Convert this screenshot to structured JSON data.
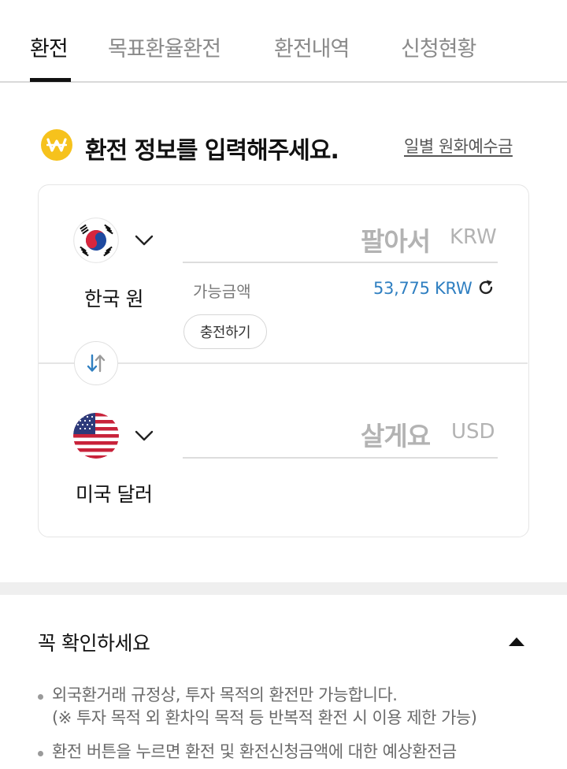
{
  "tabs": [
    {
      "label": "환전",
      "active": true
    },
    {
      "label": "목표환율환전",
      "active": false
    },
    {
      "label": "환전내역",
      "active": false
    },
    {
      "label": "신청현황",
      "active": false
    }
  ],
  "header": {
    "title": "환전 정보를 입력해주세요.",
    "deposit_link": "일별 원화예수금",
    "icon": "won-coin-icon"
  },
  "sell": {
    "currency_name": "한국 원",
    "flag": "korea-flag",
    "placeholder": "팔아서",
    "unit": "KRW",
    "available_label": "가능금액",
    "available_amount": "53,775 KRW",
    "charge_button": "충전하기"
  },
  "buy": {
    "currency_name": "미국 달러",
    "flag": "usa-flag",
    "placeholder": "살게요",
    "unit": "USD"
  },
  "notice": {
    "title": "꼭 확인하세요",
    "expanded": true,
    "items": [
      {
        "lines": [
          "외국환거래 규정상, 투자 목적의 환전만 가능합니다.",
          "(※ 투자 목적 외 환차익 목적 등 반복적 환전 시 이용 제한 가능)"
        ]
      },
      {
        "lines": [
          "환전 버튼을 누르면 환전 및 환전신청금액에 대한 예상환전금"
        ]
      }
    ]
  },
  "colors": {
    "accent_blue": "#2f7fc1",
    "won_icon_yellow": "#f6c21c",
    "placeholder_gray": "#b3b3b3"
  }
}
